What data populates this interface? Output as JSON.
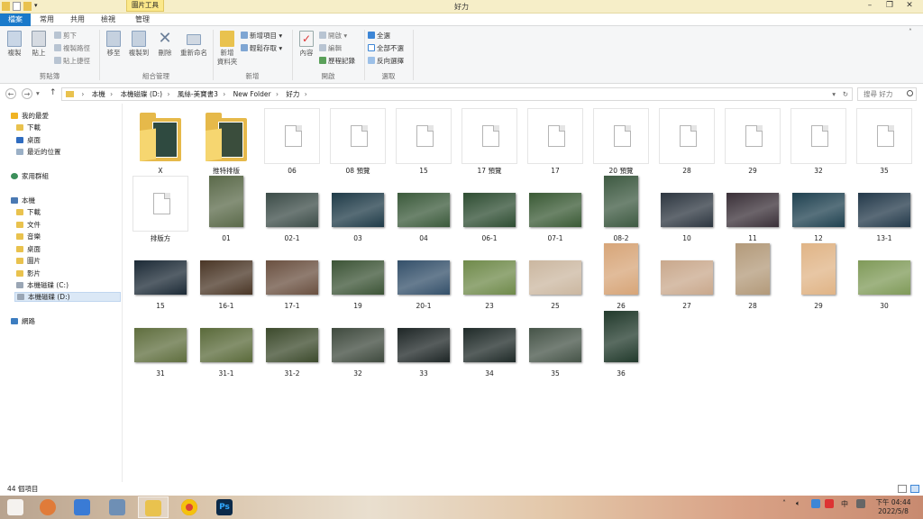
{
  "title_bar": {
    "window_title": "好力",
    "contextual_tab": "圖片工具",
    "controls": [
      "–",
      "❐",
      "✕"
    ]
  },
  "ribbon_tabs": [
    {
      "label": "檔案"
    },
    {
      "label": "常用"
    },
    {
      "label": "共用"
    },
    {
      "label": "檢視"
    },
    {
      "label": "管理"
    }
  ],
  "ribbon": {
    "clipboard": {
      "group": "剪貼簿",
      "copy": "複製",
      "paste": "貼上",
      "cut": "剪下",
      "copy_path": "複製路徑",
      "paste_shortcut": "貼上捷徑"
    },
    "organize": {
      "group": "組合管理",
      "move_to": "移至",
      "copy_to": "複製到",
      "delete": "刪除",
      "rename": "重新命名"
    },
    "new": {
      "group": "新增",
      "new_folder_line1": "新增",
      "new_folder_line2": "資料夾",
      "new_item": "新增項目 ▾",
      "easy_access": "輕鬆存取 ▾"
    },
    "open": {
      "group": "開啟",
      "properties": "內容",
      "open": "開啟 ▾",
      "edit": "編輯",
      "history": "歷程記錄"
    },
    "select": {
      "group": "選取",
      "select_all": "全選",
      "select_none": "全部不選",
      "invert": "反向選擇"
    }
  },
  "address": {
    "crumbs": [
      "本機",
      "本機磁碟 (D:)",
      "風絲-美寶書3",
      "New Folder",
      "好力"
    ],
    "separator": "›",
    "search_placeholder": "搜尋 好力"
  },
  "nav_pane": [
    {
      "label": "我的最愛"
    },
    {
      "label": "下載"
    },
    {
      "label": "桌面"
    },
    {
      "label": "最近的位置"
    },
    {
      "label": "家用群組"
    },
    {
      "label": "本機"
    },
    {
      "label": "下載"
    },
    {
      "label": "文件"
    },
    {
      "label": "音樂"
    },
    {
      "label": "桌面"
    },
    {
      "label": "圖片"
    },
    {
      "label": "影片"
    },
    {
      "label": "本機磁碟 (C:)"
    },
    {
      "label": "本機磁碟 (D:)"
    },
    {
      "label": "網路"
    }
  ],
  "items": [
    {
      "name": "X",
      "kind": "folder",
      "color": "#2f4a40"
    },
    {
      "name": "推特排版",
      "kind": "folder",
      "color": "#3a4d3c"
    },
    {
      "name": "06",
      "kind": "file"
    },
    {
      "name": "08 預覽",
      "kind": "file"
    },
    {
      "name": "15",
      "kind": "file"
    },
    {
      "name": "17 預覽",
      "kind": "file"
    },
    {
      "name": "17",
      "kind": "file"
    },
    {
      "name": "20 預覽",
      "kind": "file"
    },
    {
      "name": "28",
      "kind": "file"
    },
    {
      "name": "29",
      "kind": "file"
    },
    {
      "name": "32",
      "kind": "file"
    },
    {
      "name": "35",
      "kind": "file"
    },
    {
      "name": "排版方",
      "kind": "file"
    },
    {
      "name": "01",
      "kind": "photo",
      "orient": "portrait",
      "color": "#5b6a4a"
    },
    {
      "name": "02-1",
      "kind": "photo",
      "orient": "landscape",
      "color": "#3c4c48"
    },
    {
      "name": "03",
      "kind": "photo",
      "orient": "landscape",
      "color": "#1f3b48"
    },
    {
      "name": "04",
      "kind": "photo",
      "orient": "landscape",
      "color": "#3b5a3b"
    },
    {
      "name": "06-1",
      "kind": "photo",
      "orient": "landscape",
      "color": "#2e4d32"
    },
    {
      "name": "07-1",
      "kind": "photo",
      "orient": "landscape",
      "color": "#3a5a35"
    },
    {
      "name": "08-2",
      "kind": "photo",
      "orient": "portrait",
      "color": "#3e5a42"
    },
    {
      "name": "10",
      "kind": "photo",
      "orient": "landscape",
      "color": "#2d3640"
    },
    {
      "name": "11",
      "kind": "photo",
      "orient": "landscape",
      "color": "#3a3038"
    },
    {
      "name": "12",
      "kind": "photo",
      "orient": "landscape",
      "color": "#1f4150"
    },
    {
      "name": "13-1",
      "kind": "photo",
      "orient": "landscape",
      "color": "#23394a"
    },
    {
      "name": "15",
      "kind": "photo",
      "orient": "landscape",
      "color": "#1c2a36"
    },
    {
      "name": "16-1",
      "kind": "photo",
      "orient": "landscape",
      "color": "#4a3626"
    },
    {
      "name": "17-1",
      "kind": "photo",
      "orient": "landscape",
      "color": "#6a5040"
    },
    {
      "name": "19",
      "kind": "photo",
      "orient": "landscape",
      "color": "#3c5436"
    },
    {
      "name": "20-1",
      "kind": "photo",
      "orient": "landscape",
      "color": "#34506a"
    },
    {
      "name": "23",
      "kind": "photo",
      "orient": "landscape",
      "color": "#6f8a4a"
    },
    {
      "name": "25",
      "kind": "photo",
      "orient": "landscape",
      "color": "#cbb7a0"
    },
    {
      "name": "26",
      "kind": "photo",
      "orient": "portrait",
      "color": "#d7a578"
    },
    {
      "name": "27",
      "kind": "photo",
      "orient": "landscape",
      "color": "#c9a88c"
    },
    {
      "name": "28",
      "kind": "photo",
      "orient": "portrait",
      "color": "#b39a7a"
    },
    {
      "name": "29",
      "kind": "photo",
      "orient": "portrait",
      "color": "#e0b486"
    },
    {
      "name": "30",
      "kind": "photo",
      "orient": "landscape",
      "color": "#7f9a58"
    },
    {
      "name": "31",
      "kind": "photo",
      "orient": "landscape",
      "color": "#5f6e3e"
    },
    {
      "name": "31-1",
      "kind": "photo",
      "orient": "landscape",
      "color": "#5a6a3a"
    },
    {
      "name": "31-2",
      "kind": "photo",
      "orient": "landscape",
      "color": "#3c4a2c"
    },
    {
      "name": "32",
      "kind": "photo",
      "orient": "landscape",
      "color": "#3f4a3e"
    },
    {
      "name": "33",
      "kind": "photo",
      "orient": "landscape",
      "color": "#1e2626"
    },
    {
      "name": "34",
      "kind": "photo",
      "orient": "landscape",
      "color": "#1f2a28"
    },
    {
      "name": "35",
      "kind": "photo",
      "orient": "landscape",
      "color": "#465448"
    },
    {
      "name": "36",
      "kind": "photo",
      "orient": "portrait",
      "color": "#223a2c"
    }
  ],
  "status": {
    "count": "44 個項目"
  },
  "taskbar": {
    "apps": [
      {
        "icon": "windows-start-icon",
        "color": "#ffffff"
      },
      {
        "icon": "paint-icon",
        "color": "#e07b39"
      },
      {
        "icon": "baidu-netdisk-icon",
        "color": "#3a7bd5"
      },
      {
        "icon": "photo-viewer-icon",
        "color": "#6e8fb5"
      },
      {
        "icon": "file-explorer-icon",
        "color": "#e9c24e"
      },
      {
        "icon": "chrome-icon",
        "color": "#db4437"
      },
      {
        "icon": "photoshop-icon",
        "color": "#0b2a4a"
      }
    ],
    "ime": "中",
    "time": "下午 04:44",
    "date": "2022/5/8"
  }
}
